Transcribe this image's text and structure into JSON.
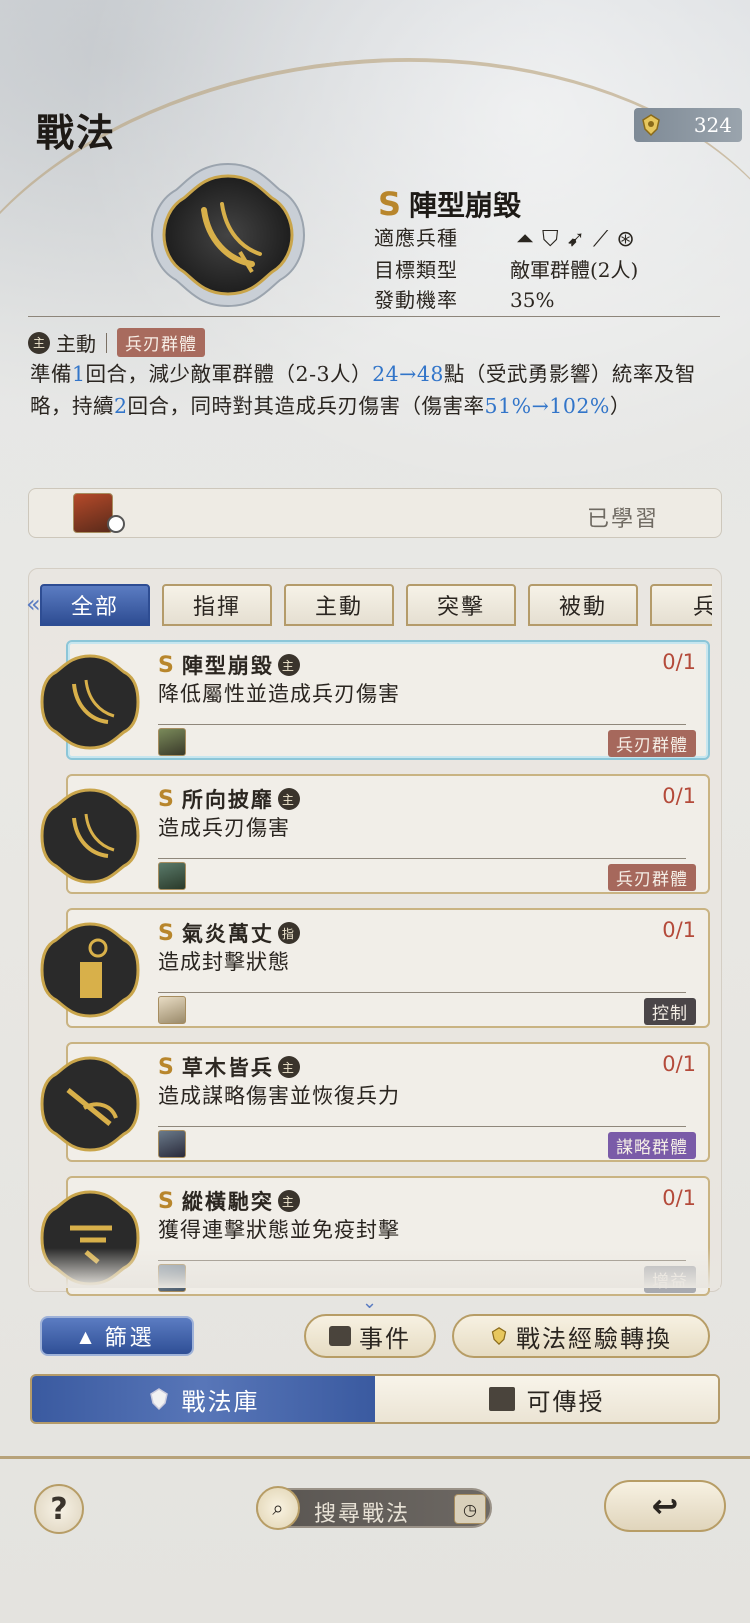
{
  "header": {
    "title": "戰法",
    "currency_value": "324"
  },
  "hero": {
    "rank": "S",
    "name": "陣型崩毀",
    "attrs": [
      {
        "key": "適應兵種",
        "value": ""
      },
      {
        "key": "目標類型",
        "value": "敵軍群體(2人)"
      },
      {
        "key": "發動機率",
        "value": "35%"
      }
    ],
    "type_badge": "主",
    "type_label": "主動",
    "tag": "兵刃群體",
    "desc_parts": [
      "準備",
      "1",
      "回合，減少敵軍群體（2-3人）",
      "24→48",
      "點（受武勇影響）統率及智略，持續",
      "2",
      "回合，同時對其造成兵刃傷害（傷害率",
      "51%→102%",
      "）"
    ]
  },
  "learned": {
    "status": "已學習"
  },
  "tabs": [
    "全部",
    "指揮",
    "主動",
    "突擊",
    "被動",
    "兵"
  ],
  "cards": [
    {
      "rank": "S",
      "name": "陣型崩毀",
      "badge": "主",
      "desc": "降低屬性並造成兵刃傷害",
      "count": "0/1",
      "tag": "兵刃群體"
    },
    {
      "rank": "S",
      "name": "所向披靡",
      "badge": "主",
      "desc": "造成兵刃傷害",
      "count": "0/1",
      "tag": "兵刃群體"
    },
    {
      "rank": "S",
      "name": "氣炎萬丈",
      "badge": "指",
      "desc": "造成封擊狀態",
      "count": "0/1",
      "tag": "控制"
    },
    {
      "rank": "S",
      "name": "草木皆兵",
      "badge": "主",
      "desc": "造成謀略傷害並恢復兵力",
      "count": "0/1",
      "tag": "謀略群體"
    },
    {
      "rank": "S",
      "name": "縱橫馳突",
      "badge": "主",
      "desc": "獲得連擊狀態並免疫封擊",
      "count": "0/1",
      "tag": "增益"
    }
  ],
  "buttons": {
    "filter": "篩選",
    "event": "事件",
    "exchange": "戰法經驗轉換"
  },
  "library": {
    "tab1": "戰法庫",
    "tab2": "可傳授"
  },
  "bottom": {
    "help": "?",
    "search_placeholder": "搜尋戰法",
    "back": "↩"
  },
  "colors": {
    "accent_blue": "#3275c9",
    "rank_gold": "#b8862c",
    "count_red": "#b44a3a"
  }
}
